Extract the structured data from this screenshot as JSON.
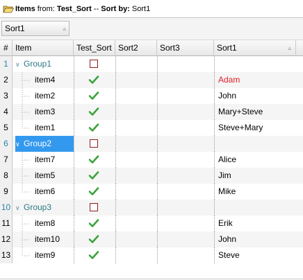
{
  "title": {
    "items_label": "Items",
    "from_label": " from: ",
    "source": "Test_Sort",
    "separator": " -- ",
    "sortby_label": "Sort by:",
    "sortby_value": " Sort1"
  },
  "group_bar": {
    "chip_label": "Sort1",
    "chip_indicator": "▵"
  },
  "columns": [
    {
      "label": "#"
    },
    {
      "label": "Item"
    },
    {
      "label": "Test_Sort"
    },
    {
      "label": "Sort2"
    },
    {
      "label": "Sort3"
    },
    {
      "label": "Sort1",
      "indicator": "▵"
    }
  ],
  "rows": [
    {
      "num": "1",
      "type": "group",
      "name": "Group1",
      "test_sort": false,
      "sort1": ""
    },
    {
      "num": "2",
      "type": "item",
      "name": "item4",
      "test_sort": true,
      "sort1": "Adam",
      "sort1_color": "#e0202a"
    },
    {
      "num": "3",
      "type": "item",
      "name": "item2",
      "test_sort": true,
      "sort1": "John"
    },
    {
      "num": "4",
      "type": "item",
      "name": "item3",
      "test_sort": true,
      "sort1": "Mary+Steve"
    },
    {
      "num": "5",
      "type": "item",
      "name": "item1",
      "test_sort": true,
      "sort1": "Steve+Mary",
      "last": true
    },
    {
      "num": "6",
      "type": "group",
      "name": "Group2",
      "test_sort": false,
      "sort1": "",
      "selected": true
    },
    {
      "num": "7",
      "type": "item",
      "name": "item7",
      "test_sort": true,
      "sort1": "Alice"
    },
    {
      "num": "8",
      "type": "item",
      "name": "item5",
      "test_sort": true,
      "sort1": "Jim"
    },
    {
      "num": "9",
      "type": "item",
      "name": "item6",
      "test_sort": true,
      "sort1": "Mike",
      "last": true
    },
    {
      "num": "10",
      "type": "group",
      "name": "Group3",
      "test_sort": false,
      "sort1": ""
    },
    {
      "num": "11",
      "type": "item",
      "name": "item8",
      "test_sort": true,
      "sort1": "Erik"
    },
    {
      "num": "12",
      "type": "item",
      "name": "item10",
      "test_sort": true,
      "sort1": "John"
    },
    {
      "num": "13",
      "type": "item",
      "name": "item9",
      "test_sort": true,
      "sort1": "Steve",
      "last": true
    }
  ],
  "colors": {
    "selection": "#3399ee",
    "group_text": "#2b7a86",
    "check_green": "#3aa33a",
    "box_border": "#8b1c1c"
  }
}
